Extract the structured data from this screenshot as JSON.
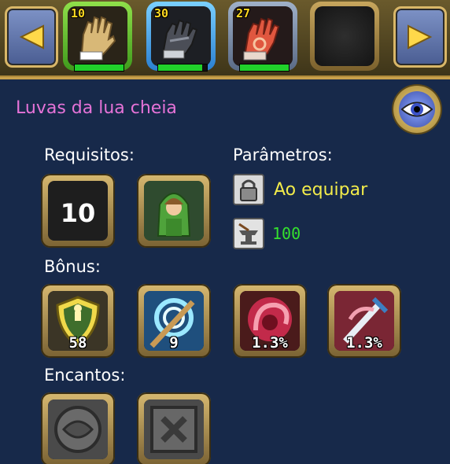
{
  "nav": {
    "prev_icon": "arrow-left-icon",
    "next_icon": "arrow-right-icon"
  },
  "slots": [
    {
      "level": "10",
      "icon": "tan-glove-icon",
      "progress": 1.0
    },
    {
      "level": "30",
      "icon": "black-gauntlet-icon",
      "progress": 0.9
    },
    {
      "level": "27",
      "icon": "red-glove-icon",
      "progress": 1.0
    },
    {
      "level": "",
      "icon": "empty-slot-icon"
    }
  ],
  "item": {
    "name": "Luvas da lua cheia"
  },
  "labels": {
    "requirements": "Requisitos:",
    "parameters": "Parâmetros:",
    "bonus": "Bônus:",
    "enchants": "Encantos:"
  },
  "requirements": {
    "level": "10",
    "class_icon": "green-hood-hero-portrait"
  },
  "parameters": {
    "equip_label": "Ao equipar",
    "equip_icon": "padlock-icon",
    "value": "100",
    "value_icon": "anvil-icon"
  },
  "bonus": [
    {
      "icon": "shield-defense-icon",
      "value": "58"
    },
    {
      "icon": "whirlwind-staff-icon",
      "value": "9"
    },
    {
      "icon": "red-swirl-icon",
      "value": "1.3%"
    },
    {
      "icon": "red-sword-crit-icon",
      "value": "1.3%"
    }
  ],
  "enchants": [
    {
      "icon": "empty-round-rune-icon"
    },
    {
      "icon": "empty-square-rune-icon"
    }
  ],
  "colors": {
    "title": "#e673d8",
    "equip": "#f3ec4a",
    "value": "#34e02e",
    "panel": "#17294a",
    "frame": "#c9a24d"
  }
}
